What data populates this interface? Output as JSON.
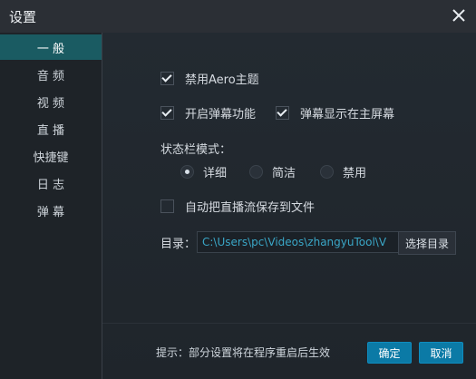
{
  "window": {
    "title": "设置"
  },
  "sidebar": {
    "items": [
      {
        "label": "一 般",
        "active": true
      },
      {
        "label": "音 频"
      },
      {
        "label": "视 频"
      },
      {
        "label": "直 播"
      },
      {
        "label": "快捷键"
      },
      {
        "label": "日 志"
      },
      {
        "label": "弹 幕"
      }
    ]
  },
  "general": {
    "aero_label": "禁用Aero主题",
    "enable_danmaku_label": "开启弹幕功能",
    "danmaku_main_screen_label": "弹幕显示在主屏幕",
    "statusbar_mode_label": "状态栏模式：",
    "mode_options": [
      "详细",
      "简洁",
      "禁用"
    ],
    "auto_save_label": "自动把直播流保存到文件",
    "dir_label": "目录：",
    "dir_value": "C:\\Users\\pc\\Videos\\zhangyuTool\\V",
    "dir_button": "选择目录"
  },
  "footer": {
    "hint": "提示：部分设置将在程序重启后生效",
    "ok_label": "确定",
    "cancel_label": "取消"
  },
  "icons": {
    "close": "close-icon",
    "check": "check-icon"
  },
  "colors": {
    "accent": "#0b7aa6",
    "sidebar_active": "#1a5b62",
    "path_text": "#3aa6c6"
  }
}
